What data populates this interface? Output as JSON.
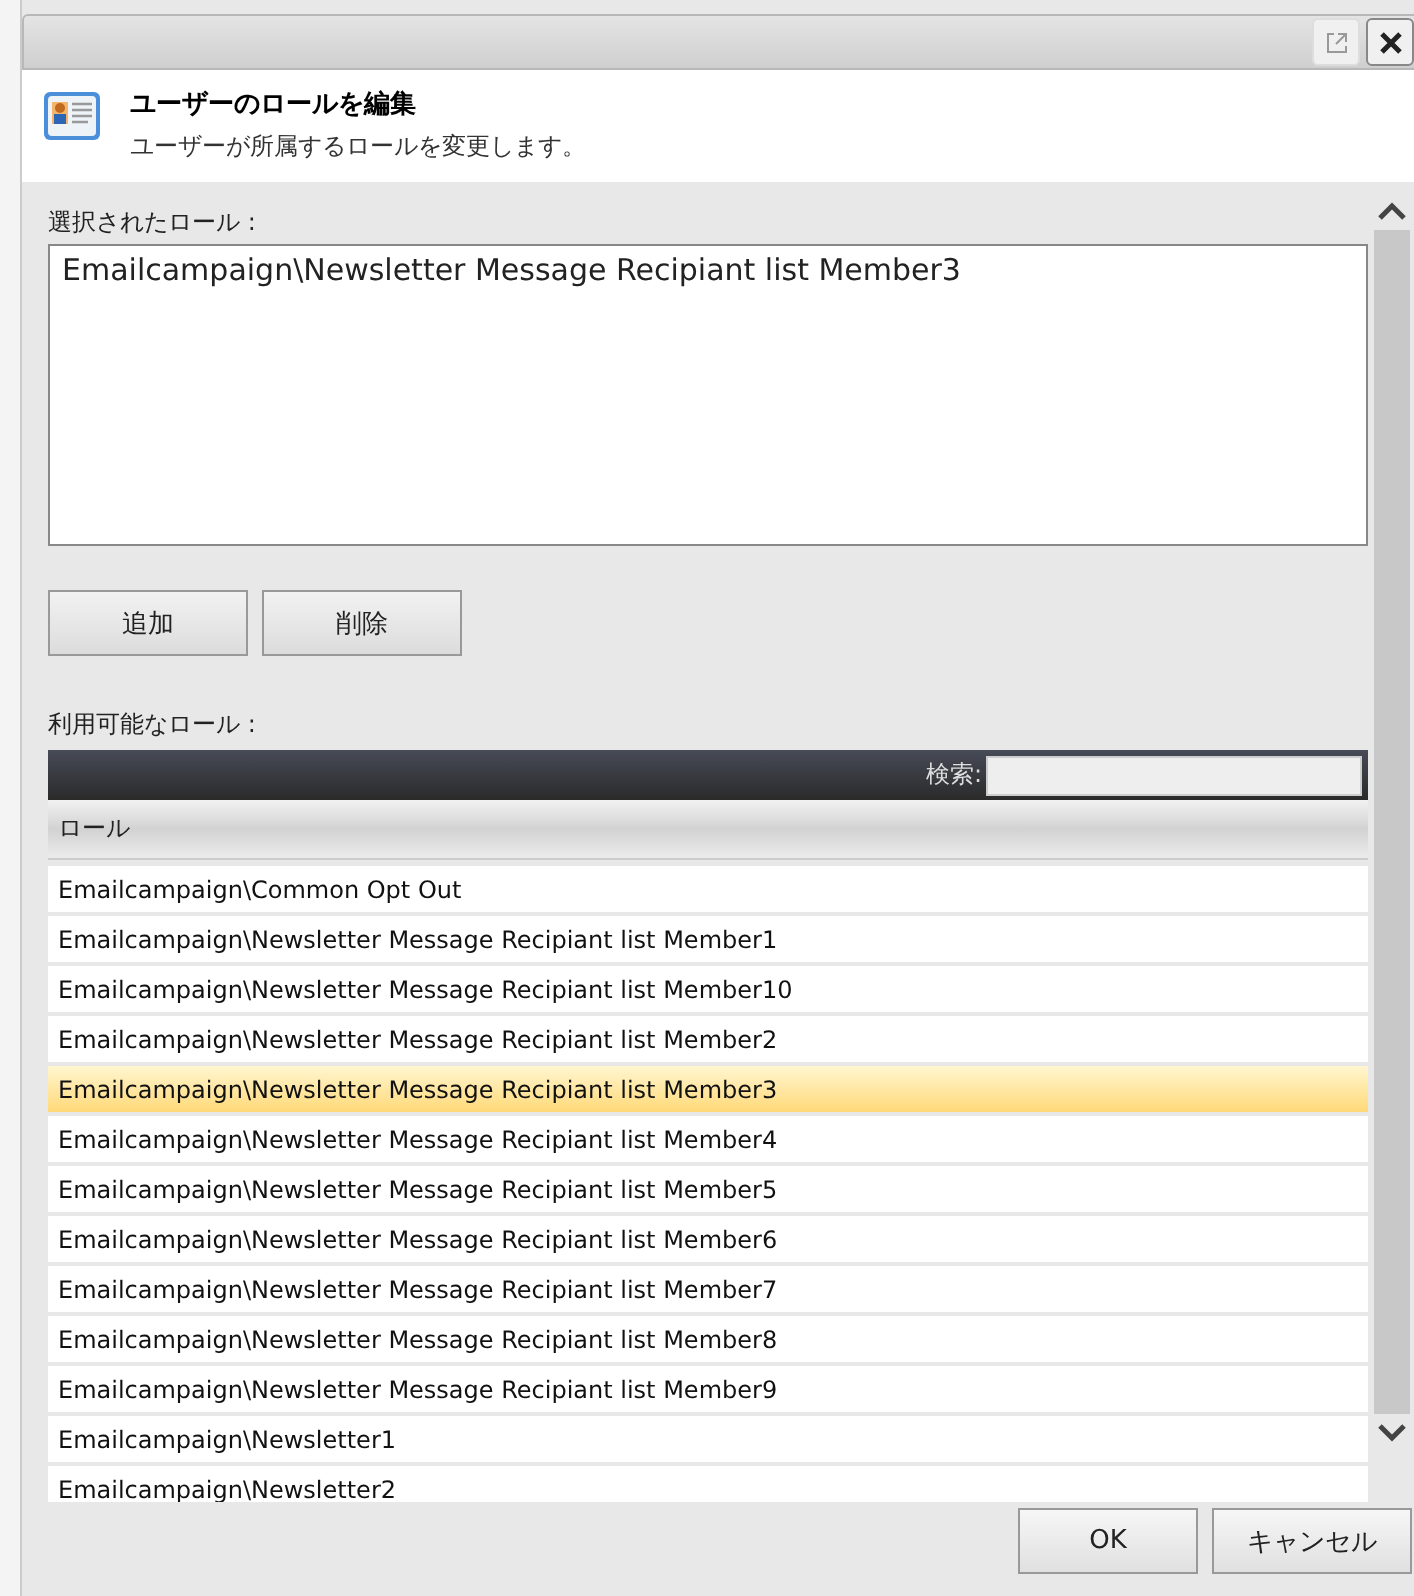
{
  "header": {
    "title": "ユーザーのロールを編集",
    "subtitle": "ユーザーが所属するロールを変更します。"
  },
  "selected_roles": {
    "label": "選択されたロール :",
    "value": "Emailcampaign\\Newsletter Message Recipiant list Member3"
  },
  "actions": [
    "追加",
    "削除"
  ],
  "available_roles": {
    "label": "利用可能なロール :",
    "search_label": "検索:",
    "column": "ロール",
    "rows": [
      {
        "name": "Emailcampaign\\Common Opt Out",
        "selected": false
      },
      {
        "name": "Emailcampaign\\Newsletter Message Recipiant list Member1",
        "selected": false
      },
      {
        "name": "Emailcampaign\\Newsletter Message Recipiant list Member10",
        "selected": false
      },
      {
        "name": "Emailcampaign\\Newsletter Message Recipiant list Member2",
        "selected": false
      },
      {
        "name": "Emailcampaign\\Newsletter Message Recipiant list Member3",
        "selected": true
      },
      {
        "name": "Emailcampaign\\Newsletter Message Recipiant list Member4",
        "selected": false
      },
      {
        "name": "Emailcampaign\\Newsletter Message Recipiant list Member5",
        "selected": false
      },
      {
        "name": "Emailcampaign\\Newsletter Message Recipiant list Member6",
        "selected": false
      },
      {
        "name": "Emailcampaign\\Newsletter Message Recipiant list Member7",
        "selected": false
      },
      {
        "name": "Emailcampaign\\Newsletter Message Recipiant list Member8",
        "selected": false
      },
      {
        "name": "Emailcampaign\\Newsletter Message Recipiant list Member9",
        "selected": false
      },
      {
        "name": "Emailcampaign\\Newsletter1",
        "selected": false
      },
      {
        "name": "Emailcampaign\\Newsletter2",
        "selected": false
      }
    ]
  },
  "footer": [
    "OK",
    "キャンセル"
  ]
}
